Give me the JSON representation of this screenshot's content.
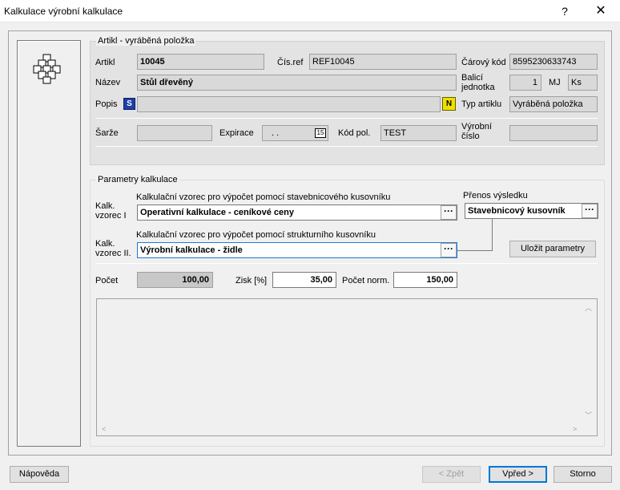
{
  "window": {
    "title": "Kalkulace výrobní kalkulace",
    "help_glyph": "?",
    "close_glyph": "✕"
  },
  "artikl_group": {
    "title": "Artikl - vyráběná položka",
    "artikl_label": "Artikl",
    "artikl_value": "10045",
    "cisref_label": "Čís.ref",
    "cisref_value": "REF10045",
    "carovy_label": "Čárový kód",
    "carovy_value": "8595230633743",
    "nazev_label": "Název",
    "nazev_value": "Stůl dřevěný",
    "balici_label_1": "Balicí",
    "balici_label_2": "jednotka",
    "balici_value": "1",
    "mj_label": "MJ",
    "mj_value": "Ks",
    "popis_label": "Popis",
    "popis_value": "",
    "popis_s_glyph": "S",
    "popis_n_glyph": "N",
    "typ_label": "Typ artiklu",
    "typ_value": "Vyráběná položka",
    "sarze_label": "Šarže",
    "sarze_value": "",
    "expirace_label": "Expirace",
    "expirace_value": ". .",
    "expirace_cal_glyph": "15",
    "kodpol_label": "Kód pol.",
    "kodpol_value": "TEST",
    "vyrobni_label_1": "Výrobní",
    "vyrobni_label_2": "číslo",
    "vyrobni_value": ""
  },
  "params_group": {
    "title": "Parametry kalkulace",
    "vzorec1_caption": "Kalkulační vzorec pro výpočet  pomocí stavebnicového kusovníku",
    "vzorec1_label_1": "Kalk.",
    "vzorec1_label_2": "vzorec I",
    "vzorec1_value": "Operativní kalkulace - ceníkové ceny",
    "vzorec2_caption": "Kalkulační vzorec pro výpočet  pomocí strukturního kusovníku",
    "vzorec2_label_1": "Kalk.",
    "vzorec2_label_2": "vzorec II.",
    "vzorec2_value": "Výrobní kalkulace - židle",
    "prenos_label": "Přenos výsledku",
    "prenos_value": "Stavebnicový kusovník",
    "ellipsis": "···",
    "ulozit_label": "Uložit parametry",
    "pocet_label": "Počet",
    "pocet_value": "100,00",
    "zisk_label": "Zisk [%]",
    "zisk_value": "35,00",
    "pocetnorm_label": "Počet norm.",
    "pocetnorm_value": "150,00"
  },
  "scroll": {
    "up": "︿",
    "down": "﹀",
    "left": "<",
    "right": ">"
  },
  "footer": {
    "napoveda": "Nápověda",
    "zpet": "< Zpět",
    "vpred": "Vpřed >",
    "storno": "Storno"
  }
}
